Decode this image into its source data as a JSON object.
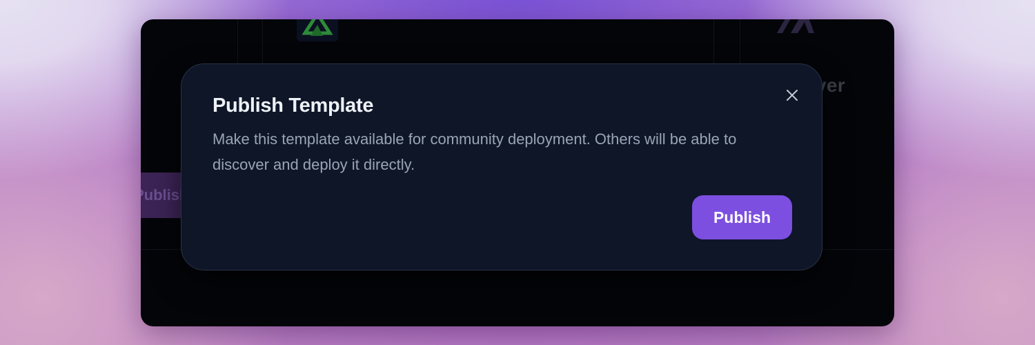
{
  "dialog": {
    "title": "Publish Template",
    "description": "Make this template available for community deployment. Others will be able to discover and deploy it directly.",
    "close_icon": "close-icon",
    "publish_label": "Publish"
  },
  "background": {
    "partial_heading": "ver",
    "partial_button_label": "Publish",
    "left_logo_icon": "triangle-logo-icon",
    "right_logo_icon": "chevron-logo-icon"
  },
  "colors": {
    "accent": "#7c4fe0",
    "modal_bg": "#0e1628",
    "app_bg": "#040509"
  }
}
